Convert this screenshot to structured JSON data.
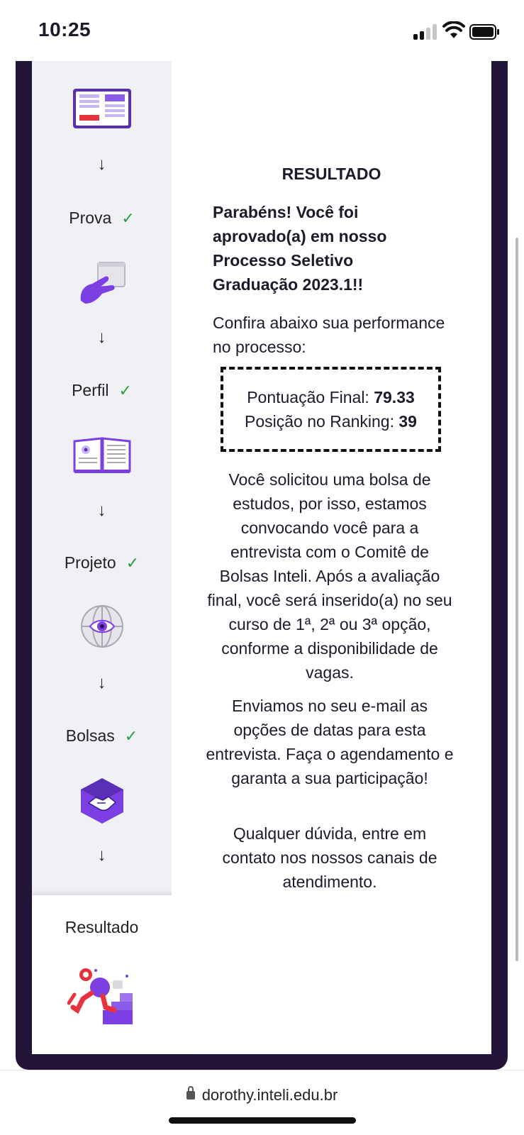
{
  "status_bar": {
    "time": "10:25"
  },
  "sidebar": {
    "steps": [
      {
        "label": "Prova",
        "check": "✓",
        "icon": "touch-hand-icon"
      },
      {
        "label": "Perfil",
        "check": "✓",
        "icon": "open-book-icon"
      },
      {
        "label": "Projeto",
        "check": "✓",
        "icon": "globe-eye-icon"
      },
      {
        "label": "Bolsas",
        "check": "✓",
        "icon": "handshake-hexagon-icon"
      }
    ],
    "arrow": "↓",
    "top_icon": "tablet-document-icon",
    "current_step": {
      "label": "Resultado",
      "icon": "runner-stairs-illustration"
    }
  },
  "content": {
    "title": "RESULTADO",
    "congrats": "Parabéns! Você foi aprovado(a) em nosso Processo Seletivo Graduação 2023.1!!",
    "confira": "Confira abaixo sua performance no processo:",
    "score": {
      "final_label": "Pontuação Final:",
      "final_value": "79.33",
      "ranking_label": "Posição no Ranking:",
      "ranking_value": "39"
    },
    "paragraphs": [
      "Você solicitou uma bolsa de estudos, por isso, estamos convocando você para a entrevista com o Comitê de Bolsas Inteli. Após a avaliação final, você será inserido(a) no seu curso de 1ª, 2ª ou 3ª opção, conforme a disponibilidade de vagas.",
      "Enviamos no seu e-mail as opções de datas para esta entrevista. Faça o agendamento e garanta a sua participação!",
      "Qualquer dúvida, entre em contato nos nossos canais de atendimento."
    ]
  },
  "browser": {
    "url": "dorothy.inteli.edu.br"
  },
  "colors": {
    "frame": "#231538",
    "accent": "#7b3fe4",
    "check": "#2e9a3a",
    "sidebar": "#f0f1f5"
  }
}
